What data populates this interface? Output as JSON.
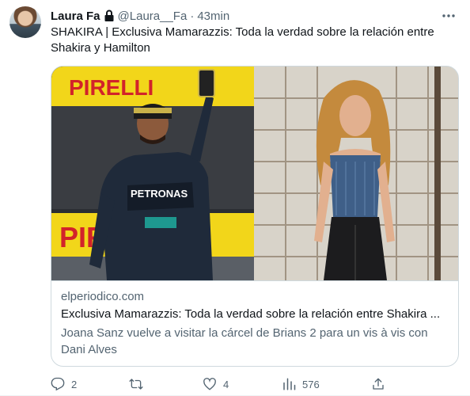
{
  "author": {
    "name": "Laura Fa",
    "handle": "@Laura__Fa",
    "separator": "·",
    "time": "43min"
  },
  "tweet": {
    "text": "SHAKIRA | Exclusiva Mamarazzis: Toda la verdad sobre la relación entre Shakira y Hamilton"
  },
  "card": {
    "left_image_text": "PIRELLI",
    "left_image_text_2": "PIRELLI",
    "suit_text": "PETRONAS",
    "domain": "elperiodico.com",
    "title": "Exclusiva Mamarazzis: Toda la verdad sobre la relación entre Shakira ...",
    "description": "Joana Sanz vuelve a visitar la cárcel de Brians 2 para un vis à vis con Dani Alves"
  },
  "actions": {
    "replies": "2",
    "retweets": "",
    "likes": "4",
    "views": "576"
  },
  "colors": {
    "accent": "#1d9bf0",
    "muted": "#536471",
    "text": "#0f1419",
    "border": "#cfd9de"
  },
  "icons": {
    "more": "more-icon",
    "lock": "lock-icon",
    "reply": "reply-icon",
    "retweet": "retweet-icon",
    "like": "like-icon",
    "views": "views-icon",
    "share": "share-icon"
  }
}
